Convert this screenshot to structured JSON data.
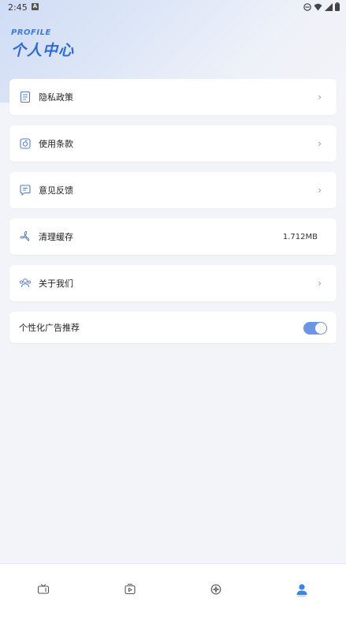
{
  "status_bar": {
    "time": "2:45",
    "notif_icon": "A"
  },
  "header": {
    "subtitle": "PROFILE",
    "title": "个人中心"
  },
  "menu": [
    {
      "label": "隐私政策",
      "icon": "document-icon",
      "chevron": "›"
    },
    {
      "label": "使用条款",
      "icon": "terms-icon",
      "chevron": "›"
    },
    {
      "label": "意见反馈",
      "icon": "feedback-icon",
      "chevron": "›"
    },
    {
      "label": "清理缓存",
      "icon": "fan-icon",
      "value": "1.712MB"
    },
    {
      "label": "关于我们",
      "icon": "people-icon",
      "chevron": "›"
    }
  ],
  "ad_toggle": {
    "label": "个性化广告推荐",
    "on": true
  },
  "bottom_nav": [
    {
      "icon": "tv-icon",
      "active": false
    },
    {
      "icon": "video-icon",
      "active": false
    },
    {
      "icon": "discover-icon",
      "active": false
    },
    {
      "icon": "profile-icon",
      "active": true
    }
  ],
  "colors": {
    "accent": "#3f7ad8",
    "toggle": "#6c95e6",
    "background": "#f3f4f9"
  }
}
